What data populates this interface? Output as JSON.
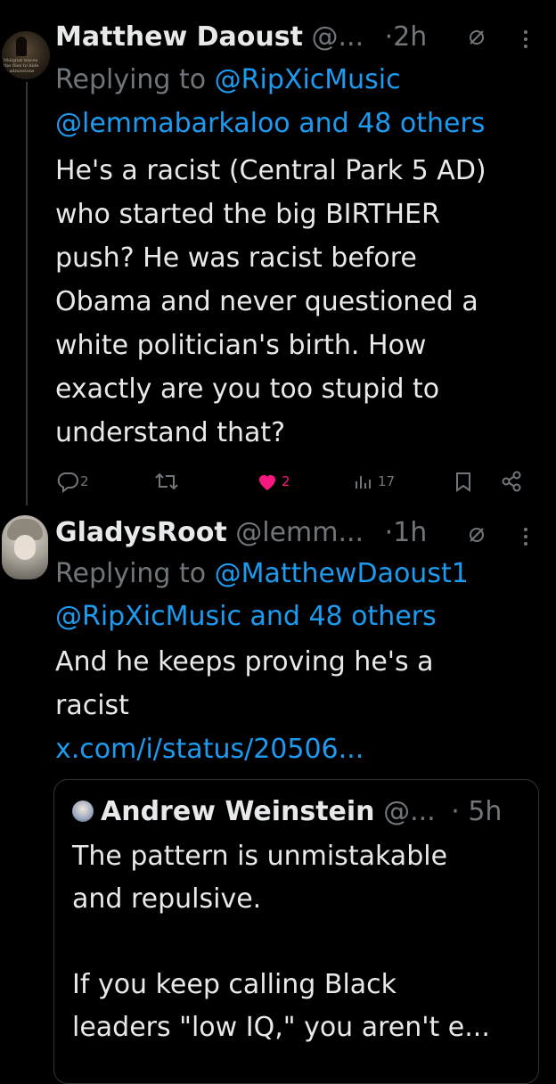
{
  "tweet1": {
    "name": "Matthew Daoust",
    "handle": "@...",
    "dot": "·",
    "time": "2h",
    "replying_prefix": "Replying to ",
    "replying_to": "@RipXicMusic",
    "mentions": "@lemmabarkaloo and 48 others",
    "body": [
      "He's a racist (Central Park 5 AD)",
      "who started the big BIRTHER",
      "push? He was racist before",
      "Obama and never questioned a",
      "white politician's birth. How",
      "exactly are you too stupid to",
      "understand that?"
    ],
    "actions": {
      "replies": "2",
      "likes": "2",
      "views": "17"
    },
    "avatar_caption": "Malgnat waces the files to hide fo admissions"
  },
  "tweet2": {
    "name": "GladysRoot",
    "handle": "@lemm...",
    "dot": "·",
    "time": "1h",
    "replying_prefix": "Replying to ",
    "replying_to": "@MatthewDaoust1",
    "mentions": "@RipXicMusic and 48 others",
    "body": [
      "And he keeps proving he's a",
      "racist"
    ],
    "link": "x.com/i/status/20506..."
  },
  "quote": {
    "name": "Andrew Weinstein",
    "handle": "@...",
    "dot": "·",
    "time": "5h",
    "body": [
      "The pattern is unmistakable",
      "and repulsive.",
      "",
      "If you keep calling Black",
      "leaders \"low IQ,\" you aren't e..."
    ]
  },
  "colors": {
    "background": "#000000",
    "text": "#e7e9ea",
    "muted": "#71767b",
    "link": "#1d9bf0",
    "like": "#f91880",
    "border": "#2f3336"
  },
  "icons": [
    "reply-icon",
    "retweet-icon",
    "heart-icon",
    "views-icon",
    "bookmark-icon",
    "share-icon",
    "grok-icon",
    "more-icon"
  ]
}
